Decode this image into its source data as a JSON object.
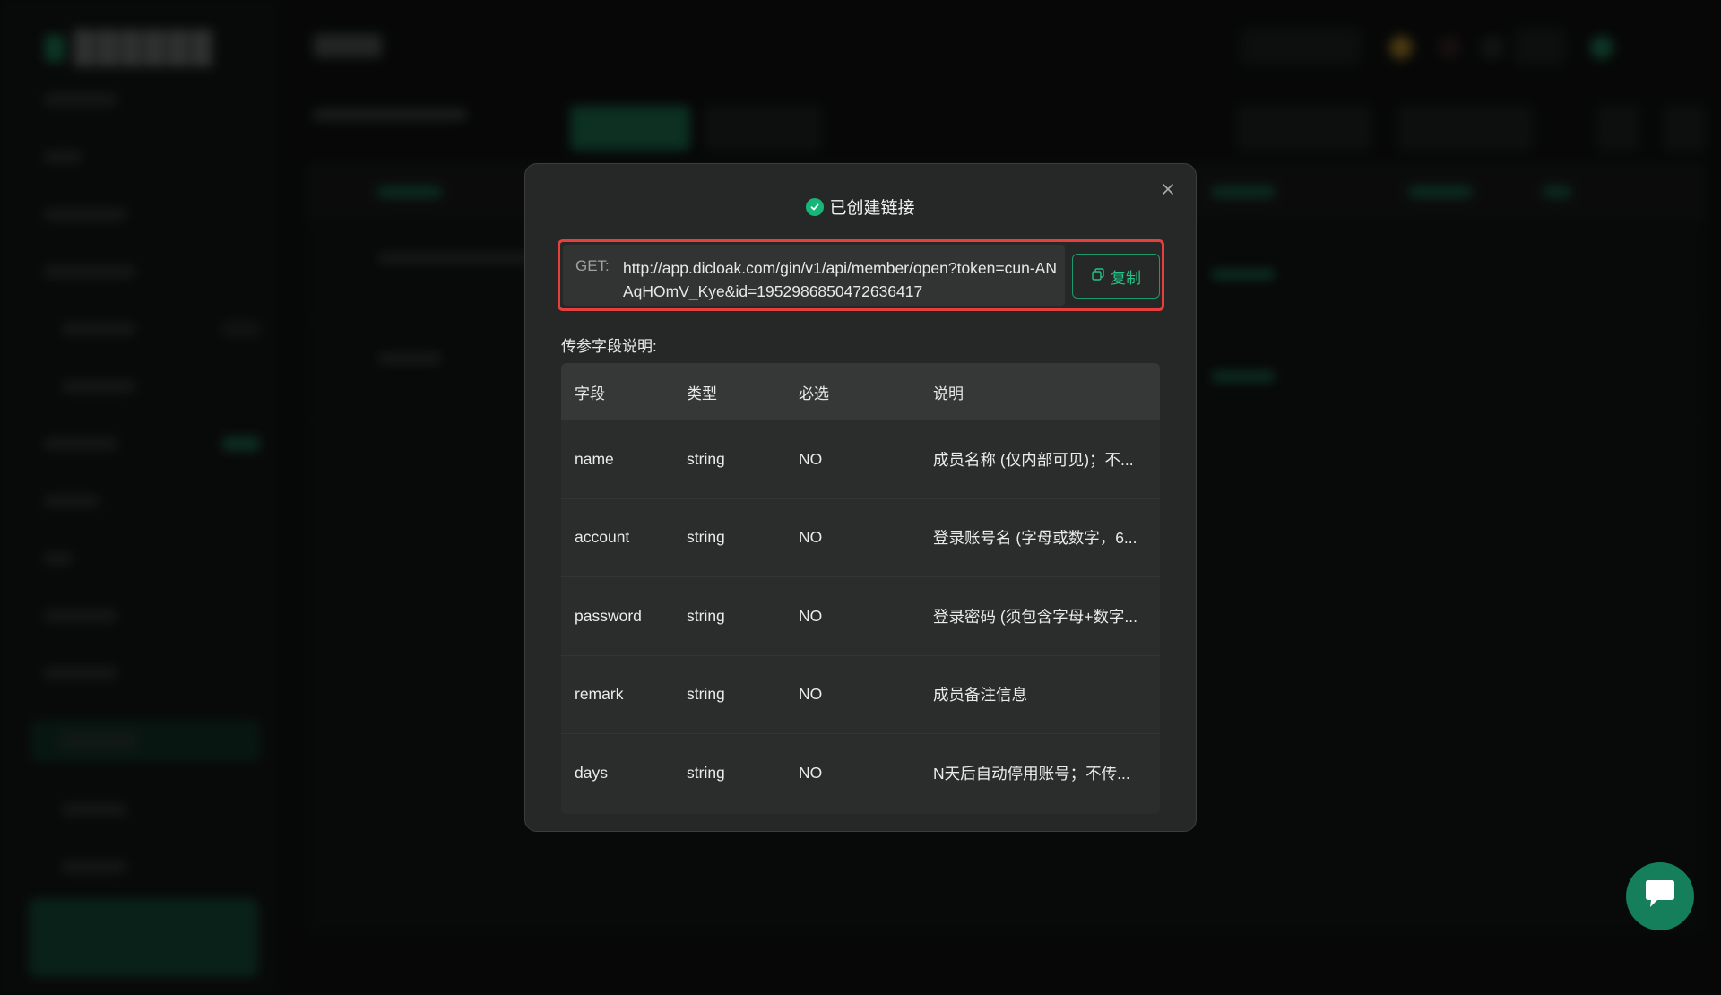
{
  "modal": {
    "title": "已创建链接",
    "url_method": "GET:",
    "url": "http://app.dicloak.com/gin/v1/api/member/open?token=cun-ANAqHOmV_Kye&id=1952986850472636417",
    "copy_label": "复制",
    "section_label": "传参字段说明:",
    "table": {
      "headers": [
        "字段",
        "类型",
        "必选",
        "说明"
      ],
      "rows": [
        {
          "field": "name",
          "type": "string",
          "required": "NO",
          "desc": "成员名称 (仅内部可见)；不..."
        },
        {
          "field": "account",
          "type": "string",
          "required": "NO",
          "desc": "登录账号名 (字母或数字，6..."
        },
        {
          "field": "password",
          "type": "string",
          "required": "NO",
          "desc": "登录密码 (须包含字母+数字..."
        },
        {
          "field": "remark",
          "type": "string",
          "required": "NO",
          "desc": "成员备注信息"
        },
        {
          "field": "days",
          "type": "string",
          "required": "NO",
          "desc": "N天后自动停用账号；不传..."
        }
      ]
    }
  },
  "colors": {
    "accent": "#18b57a",
    "highlight_border": "#e5403d",
    "modal_bg": "#262727"
  },
  "icons": {
    "title_status": "check-circle-icon",
    "close": "close-icon",
    "copy": "copy-icon",
    "chat": "chat-icon"
  }
}
